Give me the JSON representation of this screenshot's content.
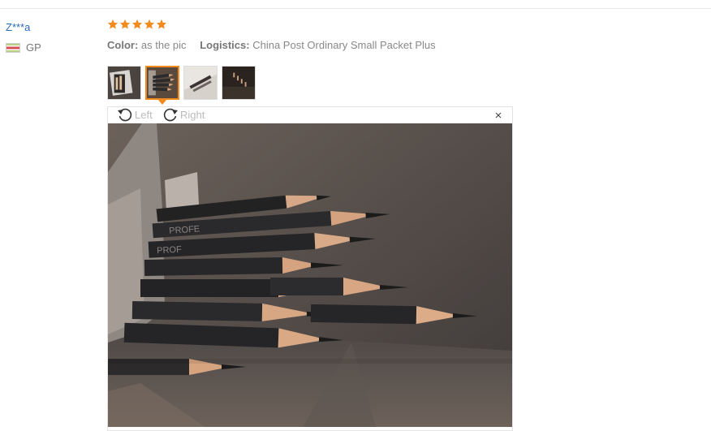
{
  "review": {
    "user_name": "Z***a",
    "country_code": "GP",
    "rating": 5,
    "color_label": "Color:",
    "color_value": "as the pic",
    "logistics_label": "Logistics:",
    "logistics_value": "China Post Ordinary Small Packet Plus",
    "thumbnails": [
      {
        "selected": false
      },
      {
        "selected": true
      },
      {
        "selected": false
      },
      {
        "selected": false
      }
    ],
    "viewer": {
      "rotate_left_label": "Left",
      "rotate_right_label": "Right",
      "close_glyph": "×"
    }
  },
  "colors": {
    "username": "#2a6bb8",
    "star": "#f28a1e",
    "selected_border": "#f28a1e"
  },
  "icons": [
    "star-icon",
    "rotate-left-icon",
    "rotate-right-icon",
    "close-icon",
    "flag-icon"
  ]
}
